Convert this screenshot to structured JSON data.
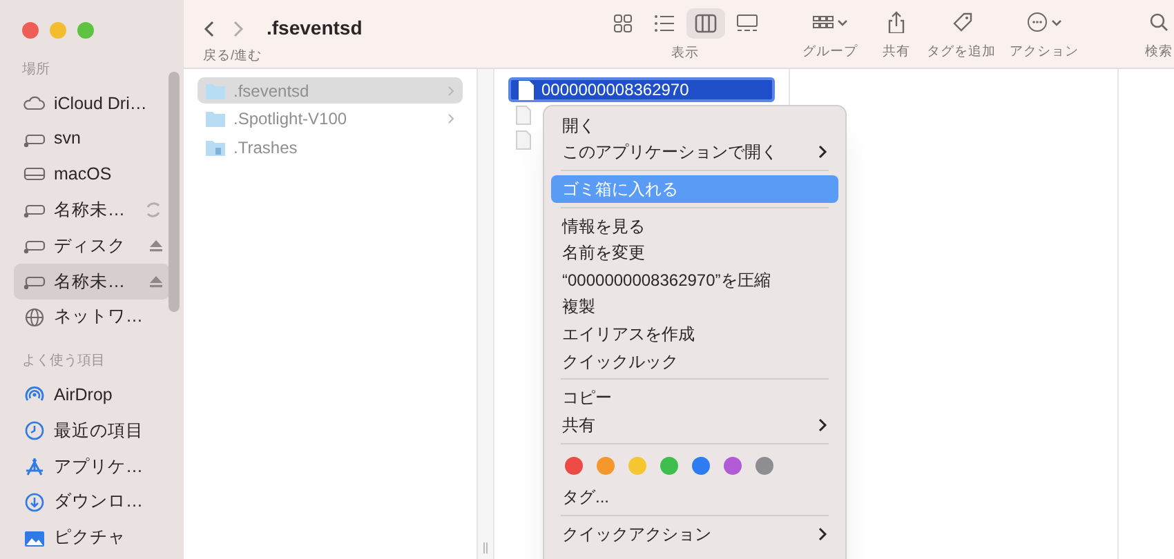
{
  "window": {
    "buttons": [
      {
        "color": "#ee5e57"
      },
      {
        "color": "#f4bd2f"
      },
      {
        "color": "#5ec341"
      }
    ]
  },
  "toolbar": {
    "nav_label": "戻る/進む",
    "title": ".fseventsd",
    "view_label": "表示",
    "views": [
      {
        "kind": "icons",
        "selected": false
      },
      {
        "kind": "list",
        "selected": false
      },
      {
        "kind": "columns",
        "selected": true
      },
      {
        "kind": "gallery",
        "selected": false
      }
    ],
    "actions": [
      {
        "kind": "group",
        "label": "グループ"
      },
      {
        "kind": "share",
        "label": "共有"
      },
      {
        "kind": "tag",
        "label": "タグを追加"
      },
      {
        "kind": "action",
        "label": "アクション"
      },
      {
        "kind": "search",
        "label": "検索"
      }
    ]
  },
  "sidebar": {
    "sections": [
      {
        "title": "場所",
        "items": [
          {
            "kind": "cloud",
            "label": "iCloud Dri…",
            "syncing": false,
            "ejectable": false,
            "selected": false
          },
          {
            "kind": "drive",
            "label": "svn",
            "syncing": false,
            "ejectable": false,
            "selected": false
          },
          {
            "kind": "disk",
            "label": "macOS",
            "syncing": false,
            "ejectable": false,
            "selected": false
          },
          {
            "kind": "drive",
            "label": "名称未…",
            "syncing": true,
            "ejectable": false,
            "selected": false
          },
          {
            "kind": "drive",
            "label": "ディスク",
            "syncing": false,
            "ejectable": true,
            "selected": false
          },
          {
            "kind": "drive",
            "label": "名称未…",
            "syncing": false,
            "ejectable": true,
            "selected": true
          },
          {
            "kind": "network",
            "label": "ネットワ…",
            "syncing": false,
            "ejectable": false,
            "selected": false
          }
        ]
      },
      {
        "title": "よく使う項目",
        "items": [
          {
            "kind": "airdrop",
            "label": "AirDrop",
            "selected": false
          },
          {
            "kind": "clock",
            "label": "最近の項目",
            "selected": false
          },
          {
            "kind": "apps",
            "label": "アプリケ…",
            "selected": false
          },
          {
            "kind": "download",
            "label": "ダウンロ…",
            "selected": false
          },
          {
            "kind": "pictures",
            "label": "ピクチャ",
            "selected": false
          }
        ]
      }
    ]
  },
  "columns": [
    {
      "items": [
        {
          "kind": "folder",
          "label": ".fseventsd",
          "selected": true,
          "has_children": true
        },
        {
          "kind": "folder",
          "label": ".Spotlight-V100",
          "selected": false,
          "has_children": true
        },
        {
          "kind": "trash-folder",
          "label": ".Trashes",
          "selected": false,
          "has_children": false
        }
      ]
    },
    {
      "items": [
        {
          "kind": "file",
          "label": "0000000008362970",
          "selected": true
        },
        {
          "kind": "file",
          "selected": false
        },
        {
          "kind": "file",
          "selected": false
        }
      ]
    }
  ],
  "context_menu": {
    "items": [
      {
        "kind": "item",
        "label": "開く",
        "submenu": false,
        "highlighted": false
      },
      {
        "kind": "item",
        "label": "このアプリケーションで開く",
        "submenu": true,
        "highlighted": false
      },
      {
        "kind": "separator"
      },
      {
        "kind": "item",
        "label": "ゴミ箱に入れる",
        "submenu": false,
        "highlighted": true
      },
      {
        "kind": "separator"
      },
      {
        "kind": "item",
        "label": "情報を見る",
        "submenu": false,
        "highlighted": false
      },
      {
        "kind": "item",
        "label": "名前を変更",
        "submenu": false,
        "highlighted": false
      },
      {
        "kind": "item",
        "label": "“0000000008362970”を圧縮",
        "submenu": false,
        "highlighted": false
      },
      {
        "kind": "item",
        "label": "複製",
        "submenu": false,
        "highlighted": false
      },
      {
        "kind": "item",
        "label": "エイリアスを作成",
        "submenu": false,
        "highlighted": false
      },
      {
        "kind": "item",
        "label": "クイックルック",
        "submenu": false,
        "highlighted": false
      },
      {
        "kind": "separator"
      },
      {
        "kind": "item",
        "label": "コピー",
        "submenu": false,
        "highlighted": false
      },
      {
        "kind": "item",
        "label": "共有",
        "submenu": true,
        "highlighted": false
      },
      {
        "kind": "separator"
      },
      {
        "kind": "tags",
        "tags": [
          {
            "color": "#ec4a45"
          },
          {
            "color": "#f4982c"
          },
          {
            "color": "#f5c630"
          },
          {
            "color": "#3ebe4c"
          },
          {
            "color": "#2d7df0"
          },
          {
            "color": "#b25bd6"
          },
          {
            "color": "#8e8e92"
          }
        ]
      },
      {
        "kind": "item",
        "label": "タグ...",
        "submenu": false,
        "highlighted": false
      },
      {
        "kind": "separator"
      },
      {
        "kind": "item",
        "label": "クイックアクション",
        "submenu": true,
        "highlighted": false
      }
    ]
  }
}
